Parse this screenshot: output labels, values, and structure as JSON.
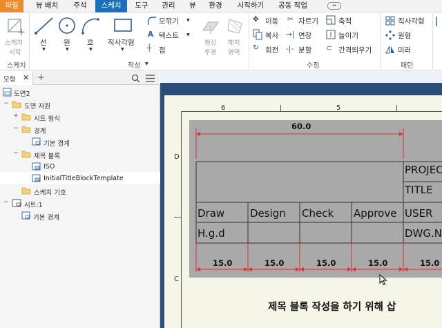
{
  "menu": {
    "tabs": [
      "파일",
      "뷰 배치",
      "주석",
      "스케치",
      "도구",
      "관리",
      "뷰",
      "환경",
      "시작하기",
      "공동 작업"
    ],
    "active_tab": "스케치",
    "extra_label": "⇔"
  },
  "ribbon": {
    "sketch_group": {
      "start_sketch_line1": "스케치",
      "start_sketch_line2": "시작",
      "label": "스케치"
    },
    "create_group": {
      "line": "선",
      "circle": "원",
      "arc": "호",
      "rectangle": "직사각형",
      "fillet": "모깎기",
      "text": "텍스트",
      "point": "점",
      "project_line1": "형상",
      "project_line2": "투영",
      "hatch_line1": "해치",
      "hatch_line2": "영역",
      "label": "작성"
    },
    "modify_group": {
      "move": "이동",
      "copy": "복사",
      "rotate": "회전",
      "trim": "자르기",
      "extend": "연장",
      "split": "분할",
      "scale": "축척",
      "stretch": "늘이기",
      "offset": "간격띄우기",
      "label": "수정"
    },
    "pattern_group": {
      "rect_pattern": "직사각형",
      "circ_pattern": "원형",
      "mirror": "미러",
      "label": "패턴"
    }
  },
  "browser": {
    "tab_label": "모형",
    "tree": {
      "root": "도면2",
      "drawing_resources": "도면 자원",
      "sheet_formats": "시트 형식",
      "borders": "경계",
      "default_border": "기본 경계",
      "title_blocks": "제목 블록",
      "iso": "ISO",
      "template": "InitialTitleBlockTemplate",
      "sketch_symbols": "스케치 기호",
      "sheet1": "시트:1",
      "sheet_default_border": "기본 경계"
    }
  },
  "drawing": {
    "zones_top": [
      "6",
      "5"
    ],
    "zones_side": [
      "D",
      "C"
    ],
    "dim_top": "60.0",
    "cells": {
      "project": "PROJEC",
      "title": "TITLE",
      "draw": "Draw",
      "design": "Design",
      "check": "Check",
      "approve": "Approve",
      "user": "USER",
      "hgd": "H.g.d",
      "dwg": "DWG.N"
    },
    "dims_bottom": [
      "15.0",
      "15.0",
      "15.0",
      "15.0",
      "15.0"
    ],
    "caption": "제목 블록 작성을 하기 위해 삽"
  }
}
